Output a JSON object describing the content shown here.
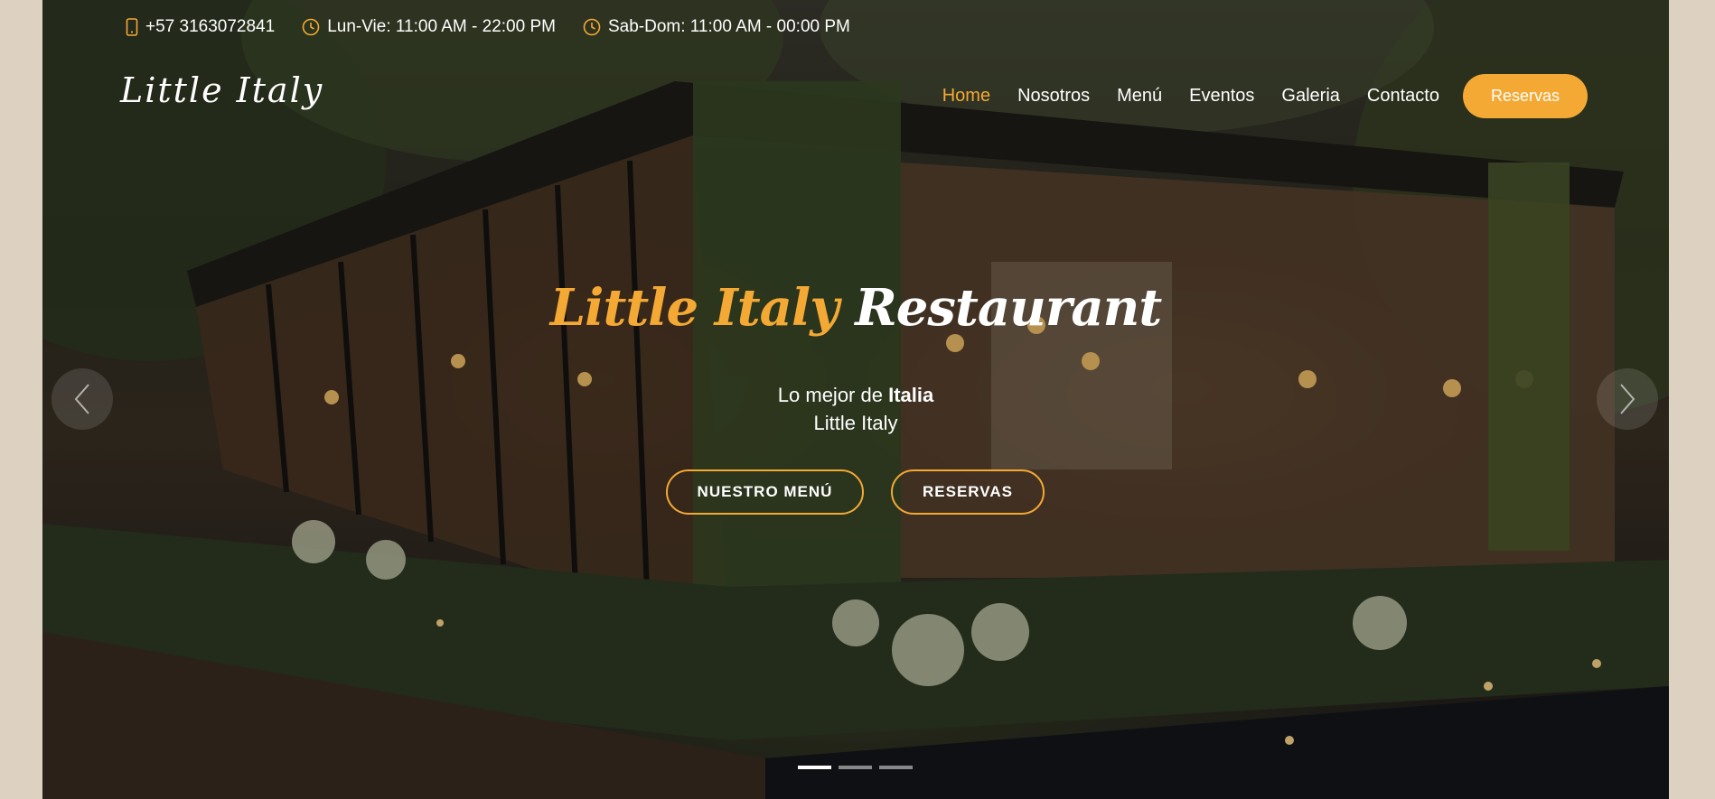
{
  "topbar": {
    "phone": "+57 3163072841",
    "weekday_hours": "Lun-Vie: 11:00 AM - 22:00 PM",
    "weekend_hours": "Sab-Dom: 11:00 AM - 00:00 PM",
    "icon_color": "#f4a934"
  },
  "brand": {
    "logo": "Little Italy"
  },
  "nav": {
    "items": [
      {
        "label": "Home",
        "active": true
      },
      {
        "label": "Nosotros"
      },
      {
        "label": "Menú"
      },
      {
        "label": "Eventos"
      },
      {
        "label": "Galeria"
      },
      {
        "label": "Contacto"
      }
    ],
    "cta_label": "Reservas"
  },
  "hero": {
    "title_accent": "Little Italy",
    "title_rest": "Restaurant",
    "subtitle_prefix": "Lo mejor de ",
    "subtitle_bold": "Italia",
    "subtitle_line2": "Little Italy",
    "btn_menu": "NUESTRO MENÚ",
    "btn_reservas": "RESERVAS",
    "accent_color": "#f4a934",
    "slides_count": 3,
    "active_slide": 1
  }
}
